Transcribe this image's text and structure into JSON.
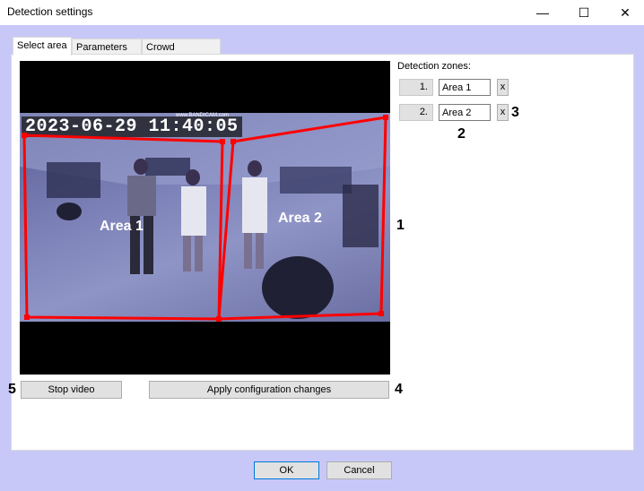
{
  "window": {
    "title": "Detection settings",
    "minimize_glyph": "—",
    "maximize_glyph": "☐",
    "close_glyph": "✕"
  },
  "tabs": [
    {
      "label": "Select area",
      "active": true
    },
    {
      "label": "Parameters",
      "active": false
    },
    {
      "label": "Crowd detection",
      "active": false
    }
  ],
  "video": {
    "timestamp": "2023-06-29 11:40:05",
    "watermark": "www.BANDICAM.com",
    "zones": [
      {
        "label": "Area 1",
        "color": "#ff0000"
      },
      {
        "label": "Area 2",
        "color": "#ff0000"
      }
    ]
  },
  "detection_zones": {
    "label": "Detection zones:",
    "items": [
      {
        "number": "1.",
        "name": "Area 1",
        "delete_label": "x"
      },
      {
        "number": "2.",
        "name": "Area 2",
        "delete_label": "x"
      }
    ]
  },
  "buttons": {
    "stop_video": "Stop video",
    "apply": "Apply configuration changes",
    "ok": "OK",
    "cancel": "Cancel"
  },
  "callouts": {
    "video": "1",
    "zone_name": "2",
    "zone_delete": "3",
    "apply": "4",
    "stop": "5"
  },
  "colors": {
    "background": "#c8c8f8",
    "zone_outline": "#ff0000"
  }
}
